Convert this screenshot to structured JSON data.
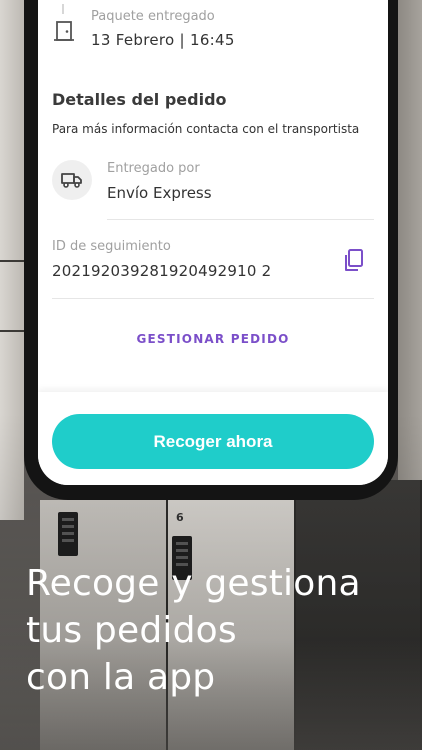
{
  "status": {
    "label": "Paquete entregado",
    "date": "13 Febrero | 16:45",
    "icon": "door-icon"
  },
  "details": {
    "title": "Detalles del pedido",
    "subtitle": "Para más información contacta con el transportista",
    "carrier": {
      "label": "Entregado por",
      "value": "Envío Express",
      "icon": "truck-icon"
    },
    "tracking": {
      "label": "ID de seguimiento",
      "value": "202192039281920492910 2",
      "copy_icon": "copy-icon"
    },
    "manage_label": "GESTIONAR PEDIDO"
  },
  "actions": {
    "pickup_label": "Recoger ahora"
  },
  "headline": {
    "line1": "Recoge y gestiona",
    "line2": "tus pedidos",
    "line3": "con la app"
  },
  "colors": {
    "accent_teal": "#1fcdca",
    "link_purple": "#7b4fc9",
    "text_dark": "#333333",
    "text_muted": "#a0a0a0"
  },
  "background": {
    "locker_number": "6"
  }
}
